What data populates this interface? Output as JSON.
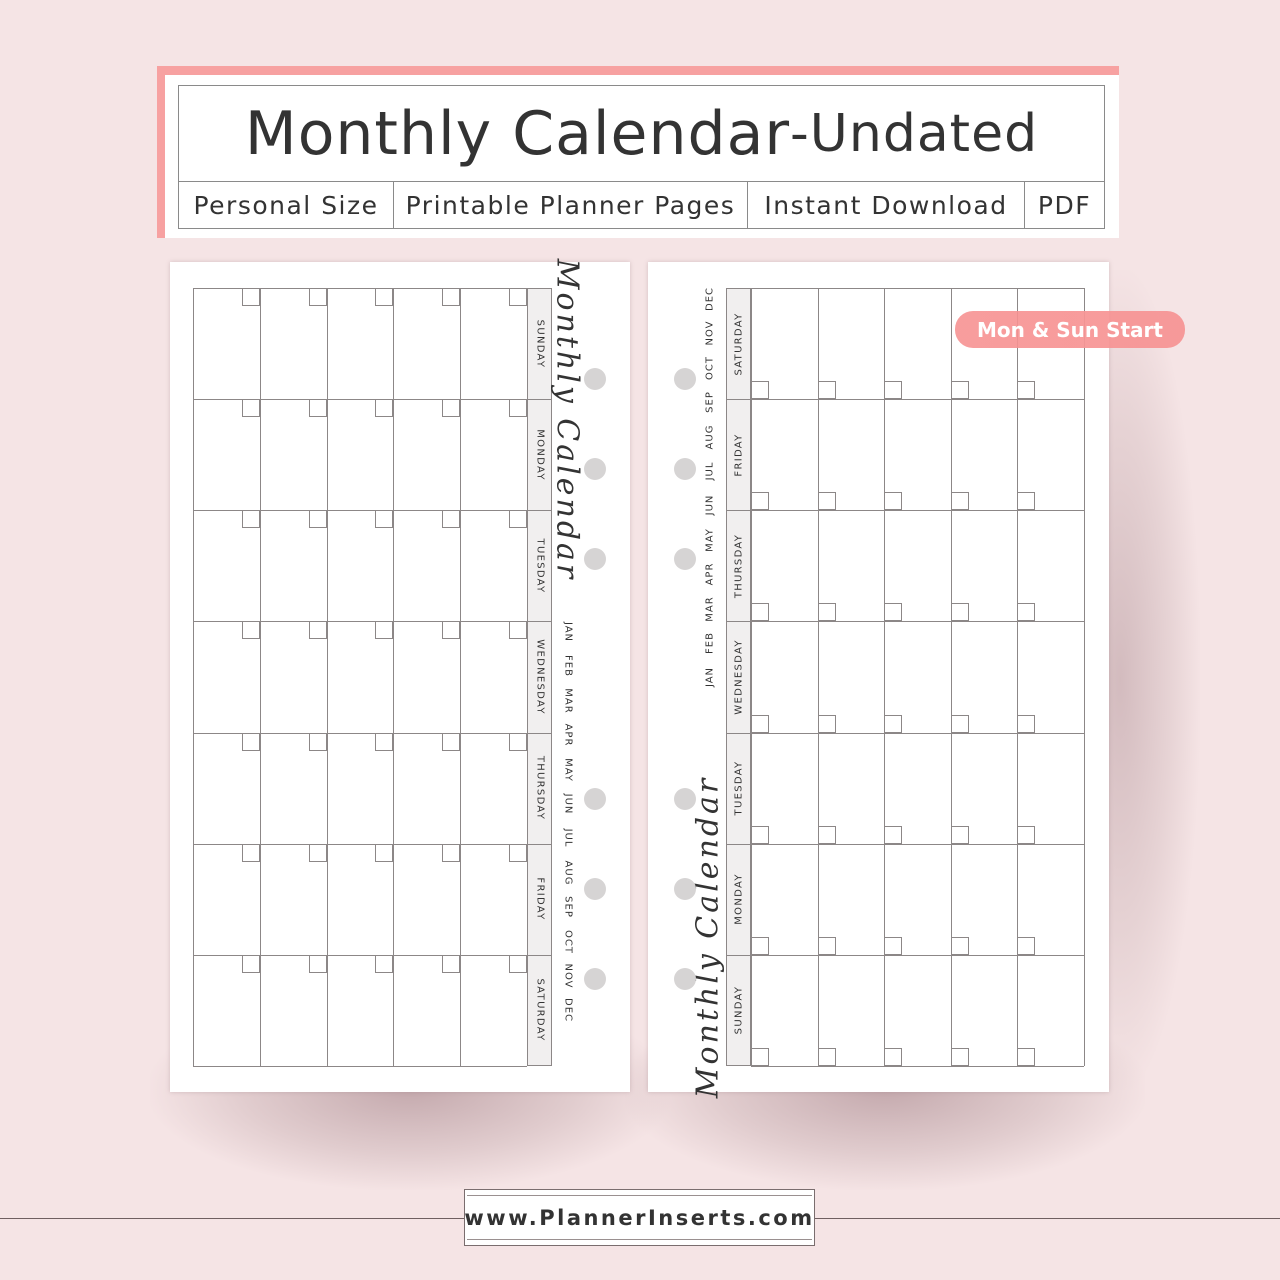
{
  "header": {
    "title_main": "Monthly Calendar",
    "title_suffix": "-Undated",
    "tags": [
      "Personal Size",
      "Printable Planner Pages",
      "Instant Download",
      "PDF"
    ]
  },
  "badge": {
    "label": "Mon & Sun Start"
  },
  "left_page": {
    "script_title": "Monthly Calendar",
    "days": [
      "SUNDAY",
      "MONDAY",
      "TUESDAY",
      "WEDNESDAY",
      "THURSDAY",
      "FRIDAY",
      "SATURDAY"
    ],
    "months": [
      "JAN",
      "FEB",
      "MAR",
      "APR",
      "MAY",
      "JUN",
      "JUL",
      "AUG",
      "SEP",
      "OCT",
      "NOV",
      "DEC"
    ],
    "columns": 5
  },
  "right_page": {
    "script_title": "Monthly Calendar",
    "days": [
      "SATURDAY",
      "FRIDAY",
      "THURSDAY",
      "WEDNESDAY",
      "TUESDAY",
      "MONDAY",
      "SUNDAY"
    ],
    "months": [
      "DEC",
      "NOV",
      "OCT",
      "SEP",
      "AUG",
      "JUL",
      "JUN",
      "MAY",
      "APR",
      "MAR",
      "FEB",
      "JAN"
    ],
    "columns": 5
  },
  "footer": {
    "website": "www.PlannerInserts.com"
  },
  "colors": {
    "accent_pink": "#f7a1a1",
    "background": "#f5e4e5",
    "badge": "#f68c8c"
  }
}
